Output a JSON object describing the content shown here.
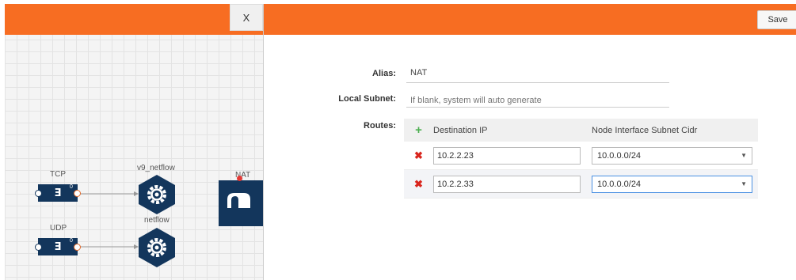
{
  "canvas": {
    "close_label": "X",
    "nodes": [
      {
        "id": "tcp",
        "label": "TCP",
        "count": "0"
      },
      {
        "id": "udp",
        "label": "UDP",
        "count": "0"
      },
      {
        "id": "v9",
        "label": "v9_netflow"
      },
      {
        "id": "netflow",
        "label": "netflow"
      },
      {
        "id": "nat",
        "label": "NAT"
      }
    ]
  },
  "panel": {
    "save_label": "Save",
    "alias": {
      "label": "Alias:",
      "value": "NAT"
    },
    "local_subnet": {
      "label": "Local Subnet:",
      "placeholder": "If blank, system will auto generate"
    },
    "routes": {
      "label": "Routes:",
      "headers": [
        "Destination IP",
        "Node Interface Subnet Cidr"
      ],
      "rows": [
        {
          "destination_ip": "10.2.2.23",
          "cidr": "10.0.0.0/24"
        },
        {
          "destination_ip": "10.2.2.33",
          "cidr": "10.0.0.0/24"
        }
      ]
    }
  },
  "colors": {
    "header": "#f76d22",
    "node": "#13365c",
    "add": "#4caf50",
    "delete": "#d9251d"
  },
  "icons": [
    "plus-icon",
    "delete-x-icon",
    "chevron-down-icon",
    "gear-icon",
    "nat-icon",
    "source-e-icon"
  ]
}
